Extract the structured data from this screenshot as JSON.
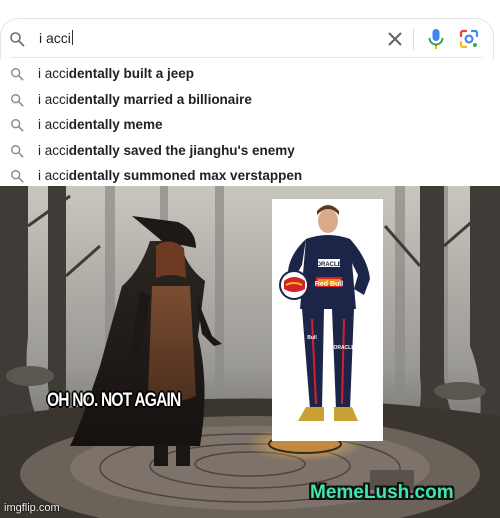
{
  "search": {
    "query": "i acci",
    "suggestions": [
      {
        "prefix": "i acci",
        "completion": "dentally built a jeep"
      },
      {
        "prefix": "i acci",
        "completion": "dentally married a billionaire"
      },
      {
        "prefix": "i acci",
        "completion": "dentally meme"
      },
      {
        "prefix": "i acci",
        "completion": "dentally saved the jianghu's enemy"
      },
      {
        "prefix": "i acci",
        "completion": "dentally summoned max verstappen"
      }
    ]
  },
  "meme": {
    "caption": "OH NO. NOT AGAIN",
    "watermark": "imgflip.com",
    "brand_logo": "MemeLush.com",
    "racer_sponsor_text": [
      "ORACLE",
      "Red Bull",
      "Bull",
      "ORACLE"
    ]
  },
  "colors": {
    "mic_blue": "#4285f4",
    "accent_red": "#ea4335",
    "accent_yellow": "#fbbc05",
    "accent_green": "#34a853",
    "logo_green": "#3ee6a8",
    "suit_navy": "#1c2547"
  },
  "icons": [
    "search-icon",
    "close-icon",
    "microphone-icon",
    "camera-lens-icon"
  ]
}
